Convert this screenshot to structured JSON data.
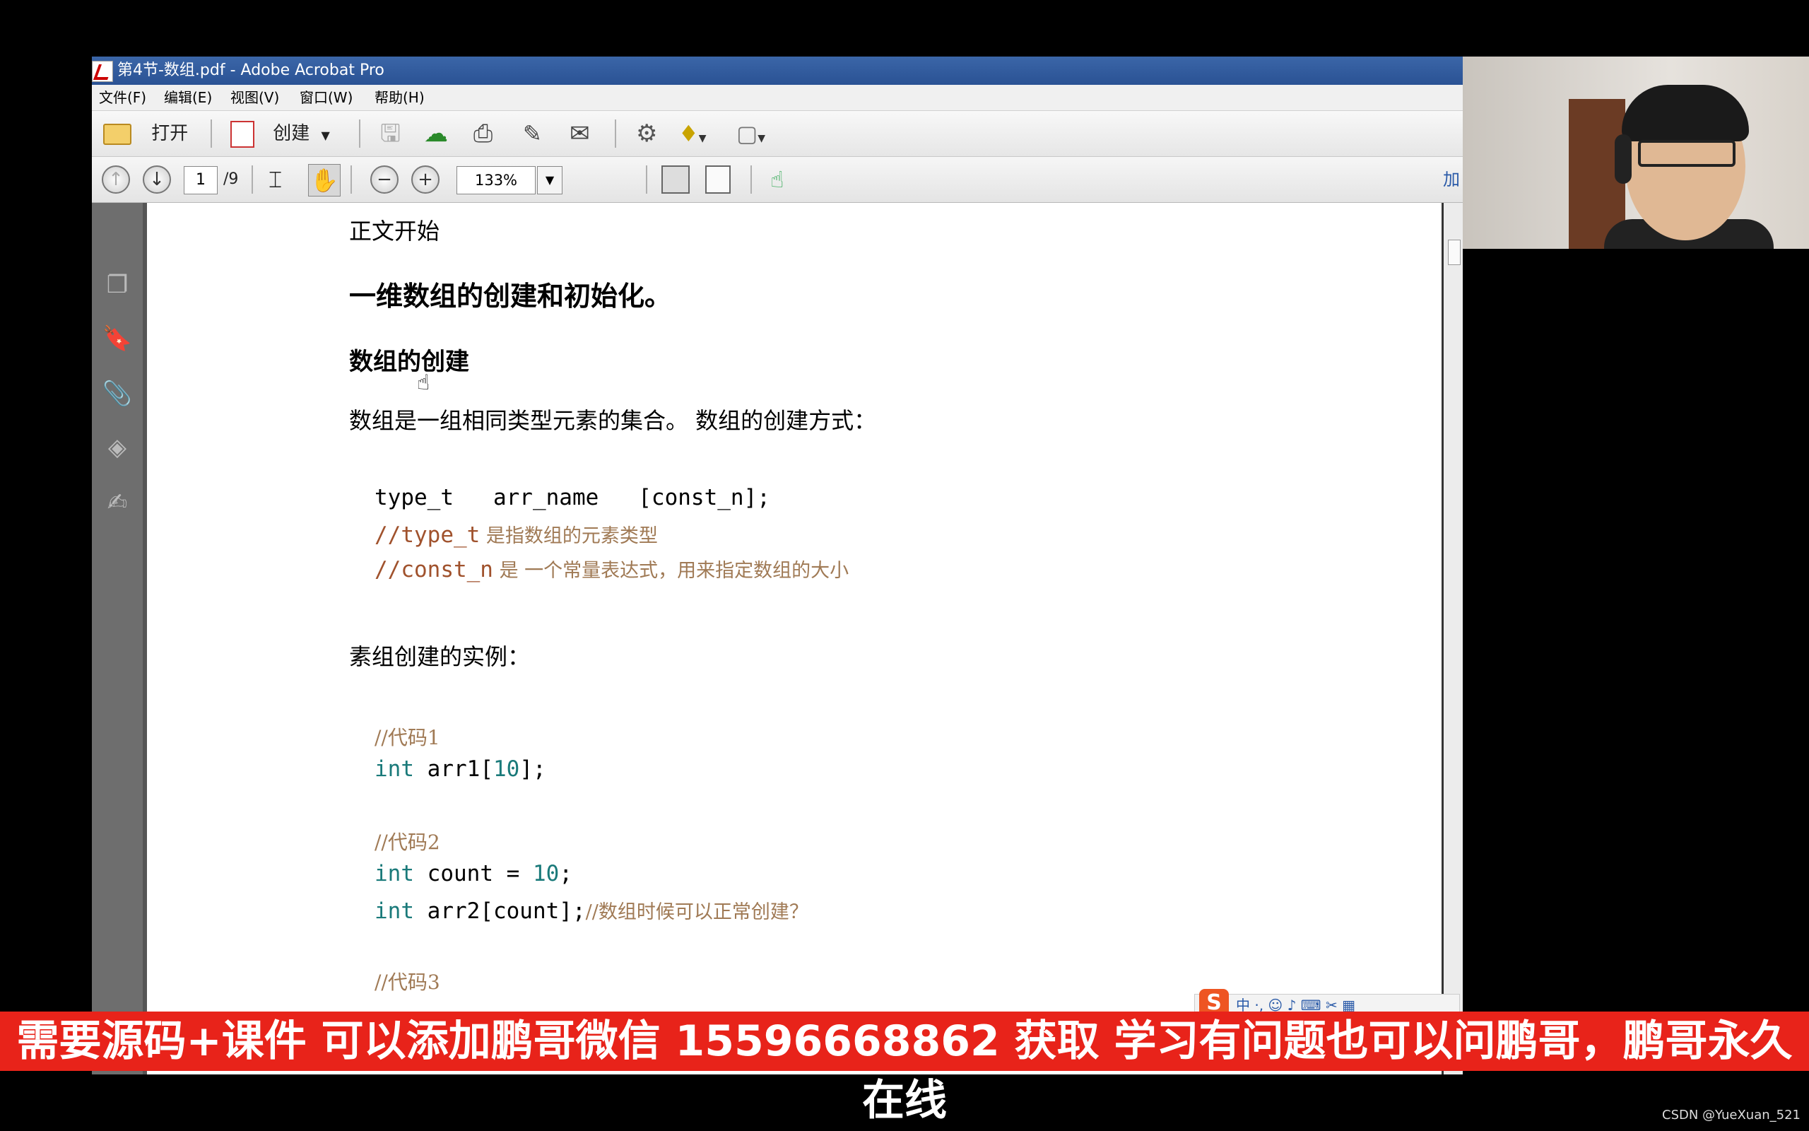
{
  "window": {
    "title": "第4节-数组.pdf - Adobe Acrobat Pro"
  },
  "menu": [
    "文件(F)",
    "编辑(E)",
    "视图(V)",
    "窗口(W)",
    "帮助(H)"
  ],
  "toolbar": {
    "open_label": "打开",
    "create_label": "创建",
    "right_label": "加"
  },
  "nav": {
    "current_page": "1",
    "total_pages": "/9",
    "zoom": "133%"
  },
  "doc": {
    "start": "正文开始",
    "h1": "一维数组的创建和初始化。",
    "h2": "数组的创建",
    "para1": "数组是一组相同类型元素的集合。 数组的创建方式：",
    "code_decl": "type_t   arr_name   [const_n];",
    "cm1_code": "//type_t",
    "cm1_cn": " 是指数组的元素类型",
    "cm2_code": "//const_n",
    "cm2_cn": " 是 一个常量表达式，用来指定数组的大小",
    "para2": "素组创建的实例：",
    "c1_comment": "//代码1",
    "c1_kw": "int",
    "c1_rest": " arr1[",
    "c1_num": "10",
    "c1_end": "];",
    "c2_comment": "//代码2",
    "c2_kw": "int",
    "c2_rest": " count = ",
    "c2_num": "10",
    "c2_end": ";",
    "c3_kw": "int",
    "c3_rest": " arr2[count];",
    "c3_comment": "//数组时候可以正常创建？",
    "c4_comment": "//代码3"
  },
  "banner": "需要源码+课件 可以添加鹏哥微信 15596668862 获取 学习有问题也可以问鹏哥，鹏哥永久在线",
  "ime": {
    "badge": "S",
    "text": "中 ·, ☺ ♪ ⌨ ✂ ▦"
  },
  "credit": "CSDN @YueXuan_521",
  "colors": {
    "banner": "#e8231a",
    "titlebar": "#2a5294",
    "keyword": "#1a7a7a",
    "comment": "#a0522d"
  }
}
